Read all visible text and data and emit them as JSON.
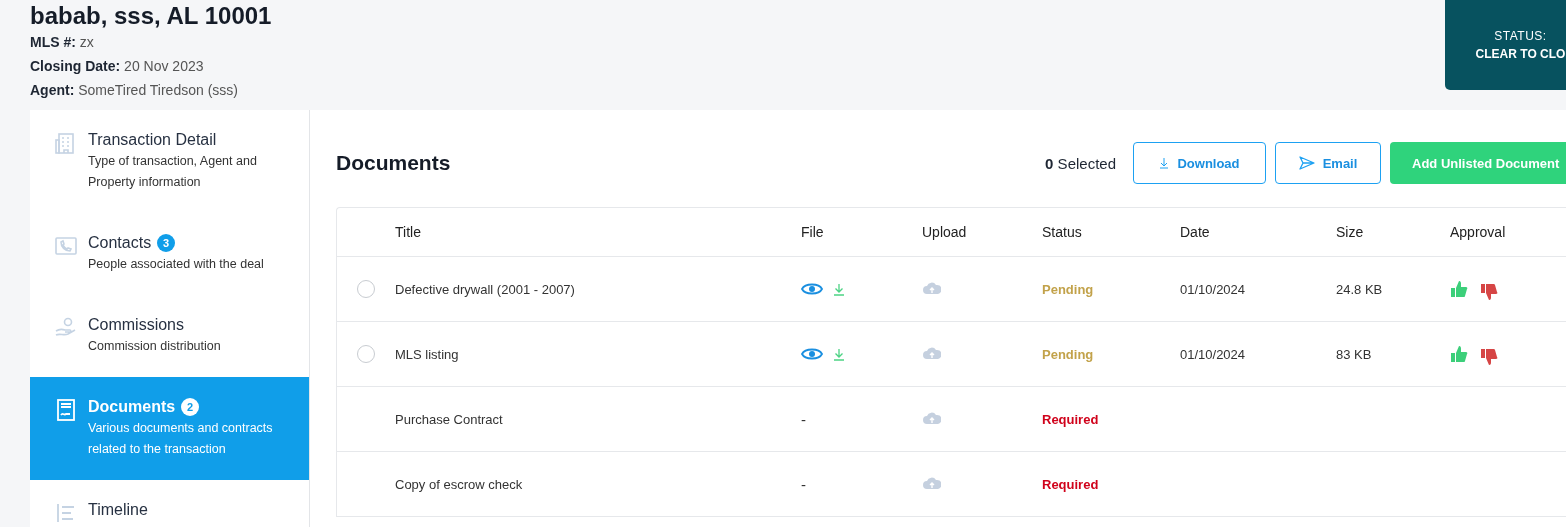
{
  "property": {
    "title": "babab, sss, AL 10001",
    "fields": [
      {
        "label": "MLS #:",
        "value": "zx"
      },
      {
        "label": "Closing Date:",
        "value": "20 Nov 2023"
      },
      {
        "label": "Agent:",
        "value": "SomeTired Tiredson (sss)"
      }
    ]
  },
  "status_card": {
    "label": "STATUS:",
    "value": "CLEAR TO CLO"
  },
  "sidebar": {
    "items": [
      {
        "kind": "building",
        "title": "Transaction Detail",
        "description": "Type of transaction, Agent and Property information",
        "selected": false
      },
      {
        "kind": "phone",
        "title": "Contacts",
        "badge": "3",
        "description": "People associated with the deal",
        "selected": false
      },
      {
        "kind": "hand",
        "title": "Commissions",
        "description": "Commission distribution",
        "selected": false
      },
      {
        "kind": "document",
        "title": "Documents",
        "badge": "2",
        "description": "Various documents and contracts related to the transaction",
        "selected": true
      },
      {
        "kind": "timeline",
        "title": "Timeline",
        "selected": false
      }
    ]
  },
  "documents": {
    "heading": "Documents",
    "selected_count": "0",
    "selected_label": "Selected",
    "buttons": [
      {
        "kind": "download",
        "label": "Download"
      },
      {
        "kind": "email",
        "label": "Email"
      },
      {
        "kind": "add",
        "label": "Add Unlisted Document"
      }
    ],
    "table": {
      "columns": [
        "Title",
        "File",
        "Upload",
        "Status",
        "Date",
        "Size",
        "Approval"
      ],
      "rows": [
        {
          "kind": "file",
          "selected": false,
          "title": "Defective drywall (2001 - 2007)",
          "status": {
            "label": "Pending",
            "color": "#c2a24a"
          },
          "date": "01/10/2024",
          "size": "24.8 KB"
        },
        {
          "kind": "file",
          "selected": false,
          "title": "MLS listing",
          "status": {
            "label": "Pending",
            "color": "#c2a24a"
          },
          "date": "01/10/2024",
          "size": "83 KB"
        },
        {
          "kind": "missing",
          "title": "Purchase Contract",
          "file": "-",
          "status": {
            "label": "Required",
            "color": "#d0021b"
          }
        },
        {
          "kind": "missing",
          "title": "Copy of escrow check",
          "file": "-",
          "status": {
            "label": "Required",
            "color": "#d0021b"
          }
        }
      ]
    }
  }
}
